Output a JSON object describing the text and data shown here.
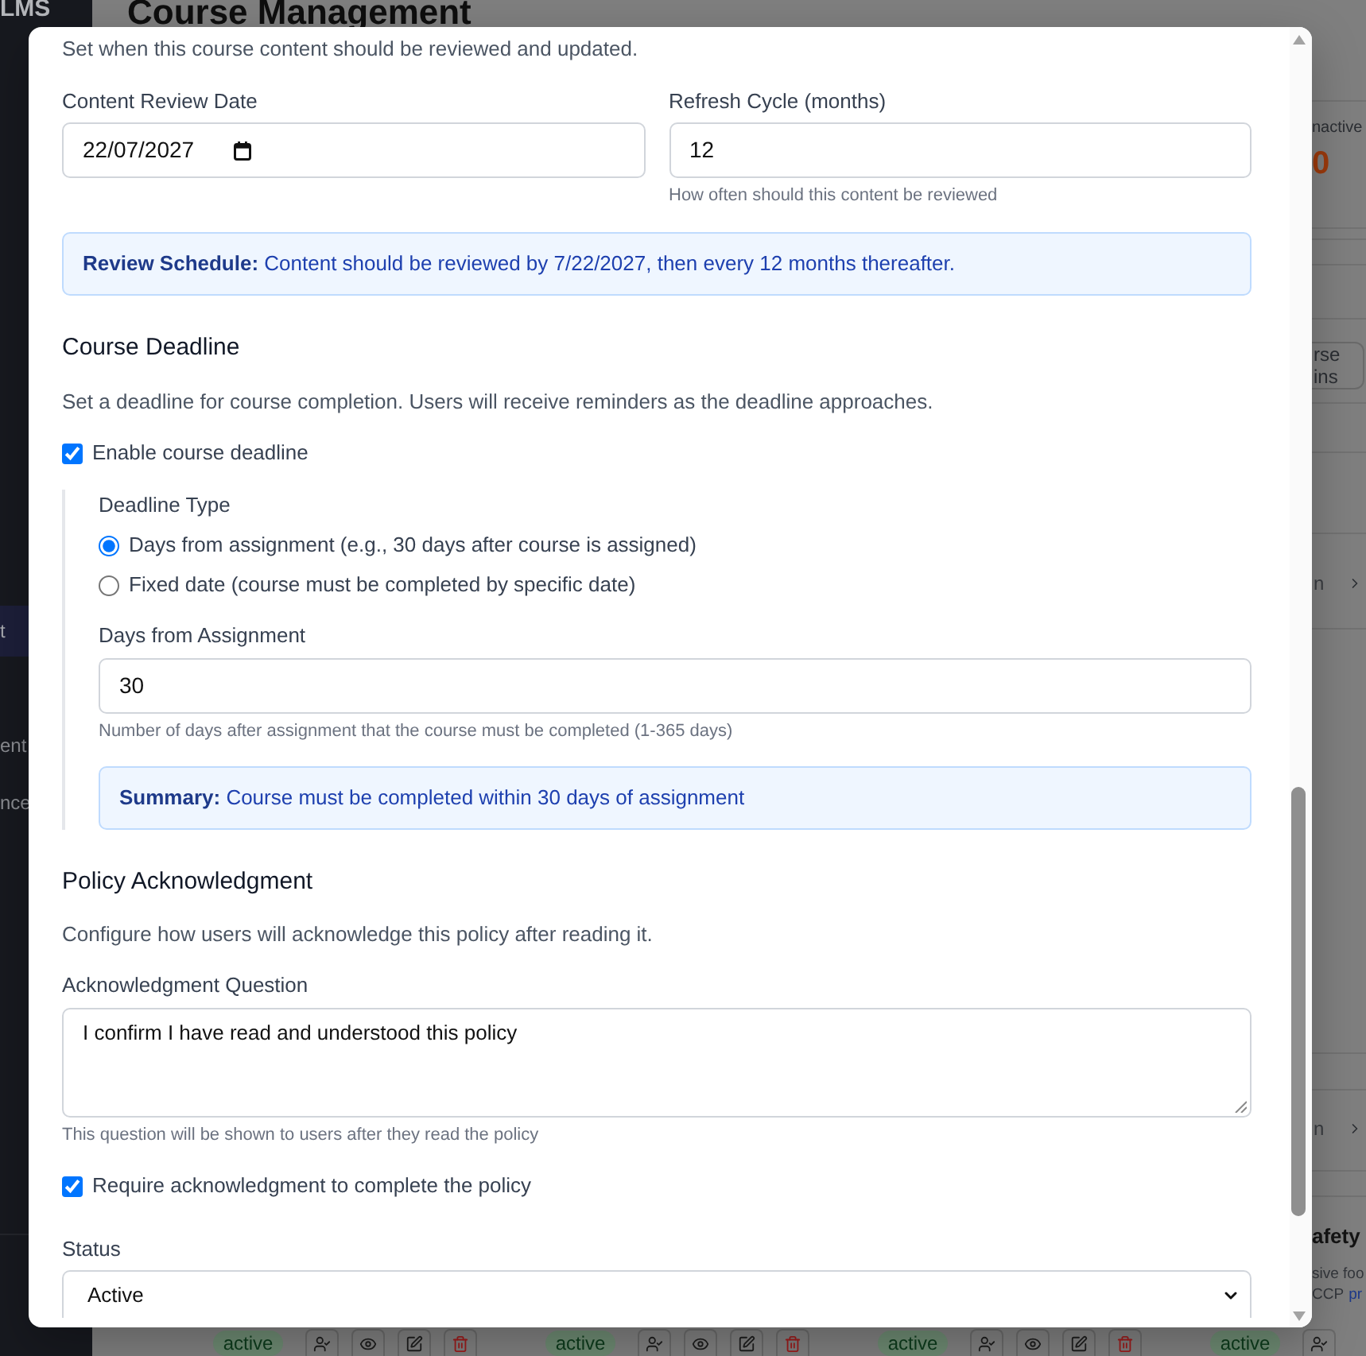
{
  "sidebar": {
    "brand": "LMS",
    "items": [
      {
        "label": "t",
        "selected": true
      },
      {
        "label": "ent",
        "selected": false
      },
      {
        "label": "nce",
        "selected": false
      }
    ]
  },
  "page": {
    "title": "Course Management"
  },
  "background_panel": {
    "stat": {
      "label": "nactive",
      "value": "0"
    },
    "button": "rse ins",
    "rows": [
      {
        "label": "n"
      },
      {
        "label": "n"
      }
    ],
    "course": {
      "title": "afety",
      "description": "sive foo",
      "tag": "CCP",
      "link": "pr"
    }
  },
  "table_row": [
    {
      "status": "active",
      "actions": [
        {
          "kind": "assign"
        },
        {
          "kind": "view"
        },
        {
          "kind": "edit"
        },
        {
          "kind": "delete"
        }
      ]
    },
    {
      "status": "active",
      "actions": [
        {
          "kind": "assign"
        },
        {
          "kind": "view"
        },
        {
          "kind": "edit"
        },
        {
          "kind": "delete"
        }
      ]
    },
    {
      "status": "active",
      "actions": [
        {
          "kind": "assign"
        },
        {
          "kind": "view"
        },
        {
          "kind": "edit"
        },
        {
          "kind": "delete"
        }
      ]
    },
    {
      "status": "active",
      "actions": [
        {
          "kind": "assign"
        }
      ]
    }
  ],
  "modal": {
    "review": {
      "description": "Set when this course content should be reviewed and updated.",
      "date_field": {
        "label": "Content Review Date",
        "value": "22/07/2027"
      },
      "cycle_field": {
        "label": "Refresh Cycle (months)",
        "value": "12",
        "hint": "How often should this content be reviewed"
      },
      "notice": "**Review Schedule:** Content should be reviewed by 7/22/2027, then every 12 months thereafter."
    },
    "deadline": {
      "heading": "Course Deadline",
      "description": "Set a deadline for course completion. Users will receive reminders as the deadline approaches.",
      "enable": {
        "label": "Enable course deadline",
        "checked": true
      },
      "type_label": "Deadline Type",
      "options": [
        {
          "label": "Days from assignment (e.g., 30 days after course is assigned)",
          "selected": true
        },
        {
          "label": "Fixed date (course must be completed by specific date)",
          "selected": false
        }
      ],
      "days_field": {
        "label": "Days from Assignment",
        "value": "30",
        "hint": "Number of days after assignment that the course must be completed (1-365 days)"
      },
      "summary": "**Summary:** Course must be completed within 30 days of assignment"
    },
    "acknowledgment": {
      "heading": "Policy Acknowledgment",
      "description": "Configure how users will acknowledge this policy after reading it.",
      "question_field": {
        "label": "Acknowledgment Question",
        "value": "I confirm I have read and understood this policy",
        "hint": "This question will be shown to users after they read the policy"
      },
      "require": {
        "label": "Require acknowledgment to complete the policy",
        "checked": true
      }
    },
    "status_field": {
      "label": "Status",
      "value": "Active"
    }
  }
}
